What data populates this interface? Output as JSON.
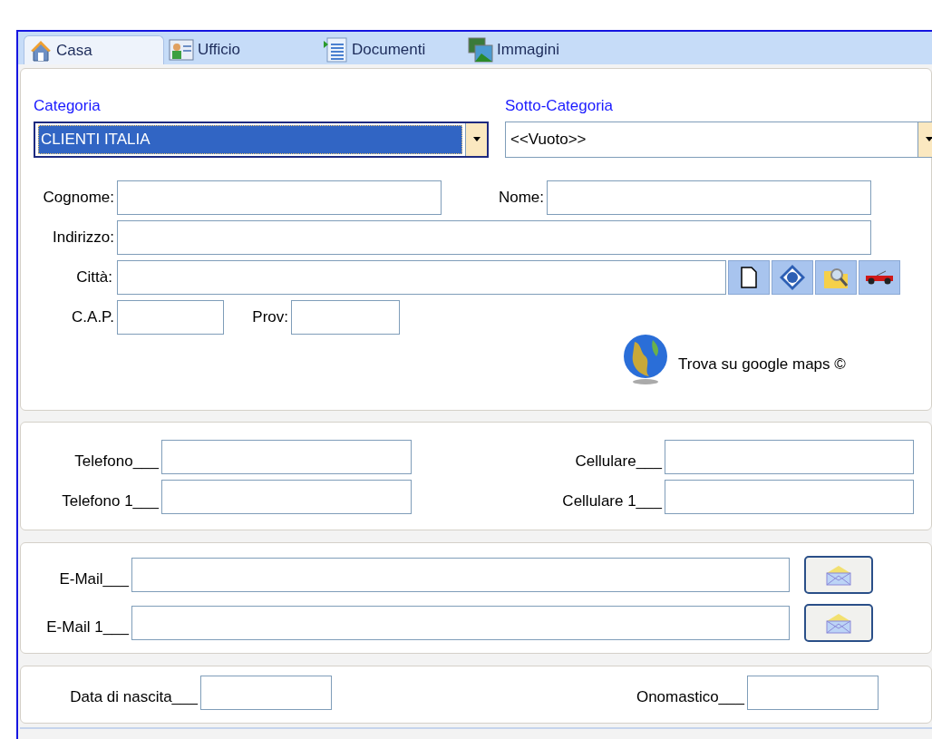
{
  "tabs": [
    {
      "label": "Casa",
      "selected": true
    },
    {
      "label": "Ufficio",
      "selected": false
    },
    {
      "label": "Documenti",
      "selected": false
    },
    {
      "label": "Immagini",
      "selected": false
    }
  ],
  "categoria": {
    "label": "Categoria",
    "value": "CLIENTI ITALIA",
    "focused": true
  },
  "sotto_categoria": {
    "label": "Sotto-Categoria",
    "value": "<<Vuoto>>",
    "focused": false
  },
  "address": {
    "cognome": "Cognome:",
    "nome": "Nome:",
    "indirizzo": "Indirizzo:",
    "citta": "Città:",
    "cap": "C.A.P.",
    "prov": "Prov:",
    "maps_link": "Trova su google maps ©"
  },
  "phones": [
    {
      "label": "Telefono___",
      "label_right": "Cellulare___"
    },
    {
      "label": "Telefono 1___",
      "label_right": "Cellulare 1___"
    }
  ],
  "emails": [
    {
      "label": "E-Mail___"
    },
    {
      "label": "E-Mail 1___"
    }
  ],
  "dates": {
    "birth": "Data di nascita___",
    "name_day": "Onomastico___"
  }
}
